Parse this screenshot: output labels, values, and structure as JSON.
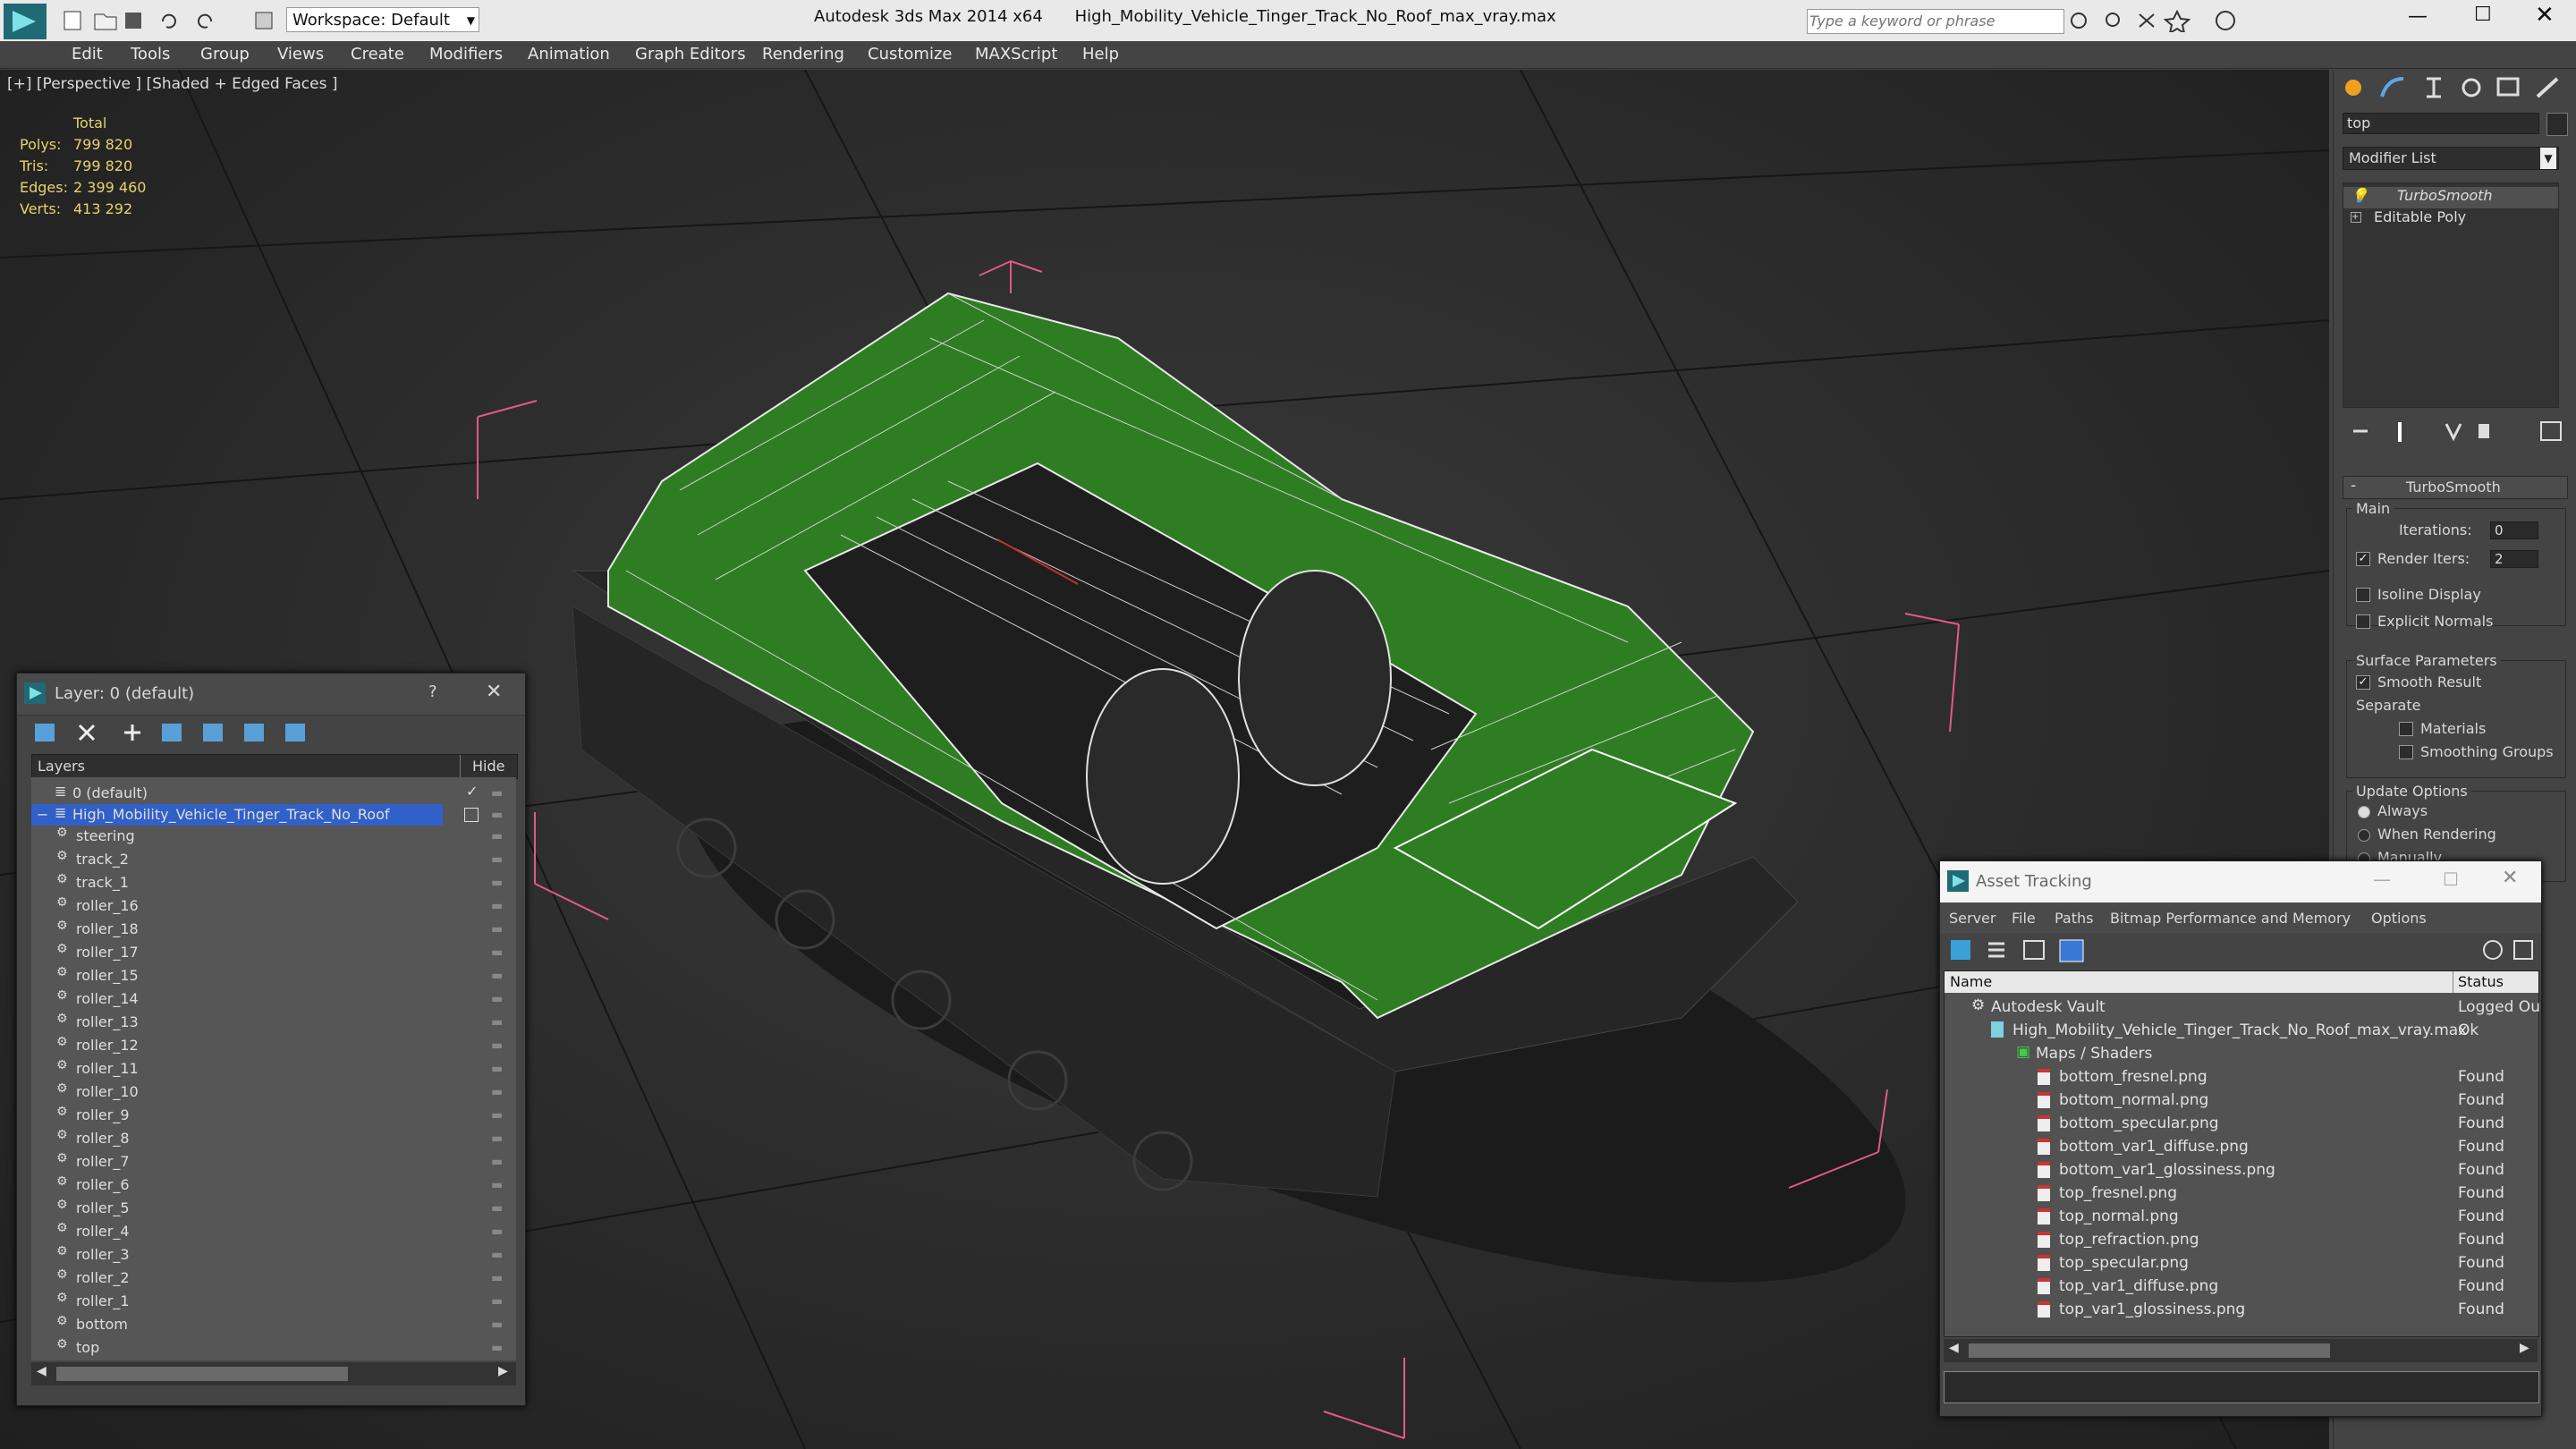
{
  "app": {
    "product": "Autodesk 3ds Max  2014 x64",
    "filename": "High_Mobility_Vehicle_Tinger_Track_No_Roof_max_vray.max",
    "workspace": "Workspace: Default",
    "search_placeholder": "Type a keyword or phrase"
  },
  "menu": [
    "Edit",
    "Tools",
    "Group",
    "Views",
    "Create",
    "Modifiers",
    "Animation",
    "Graph Editors",
    "Rendering",
    "Customize",
    "MAXScript",
    "Help"
  ],
  "viewport": {
    "label": "[+] [Perspective ] [Shaded + Edged Faces ]",
    "stats": {
      "header": "Total",
      "polys_label": "Polys:",
      "polys": "799 820",
      "tris_label": "Tris:",
      "tris": "799 820",
      "edges_label": "Edges:",
      "edges": "2 399 460",
      "verts_label": "Verts:",
      "verts": "413 292"
    }
  },
  "command_panel": {
    "object_name": "top",
    "modifier_list": "Modifier List",
    "stack": [
      "TurboSmooth",
      "Editable Poly"
    ],
    "rollout_title": "TurboSmooth",
    "main_group": "Main",
    "iterations_label": "Iterations:",
    "iterations_value": "0",
    "render_iters_label": "Render Iters:",
    "render_iters_value": "2",
    "isoline": "Isoline Display",
    "explicit_normals": "Explicit Normals",
    "surface_group": "Surface Parameters",
    "smooth_result": "Smooth Result",
    "separate": "Separate",
    "materials": "Materials",
    "smoothing_groups": "Smoothing Groups",
    "update_group": "Update Options",
    "always": "Always",
    "when_rendering": "When Rendering",
    "manually": "Manually"
  },
  "layer_window": {
    "title": "Layer: 0 (default)",
    "help": "?",
    "col_layers": "Layers",
    "col_hide": "Hide",
    "layers": [
      {
        "name": "0 (default)",
        "indent": 0
      },
      {
        "name": "High_Mobility_Vehicle_Tinger_Track_No_Roof",
        "indent": 0,
        "selected": true
      }
    ],
    "objects": [
      "steering",
      "track_2",
      "track_1",
      "roller_16",
      "roller_18",
      "roller_17",
      "roller_15",
      "roller_14",
      "roller_13",
      "roller_12",
      "roller_11",
      "roller_10",
      "roller_9",
      "roller_8",
      "roller_7",
      "roller_6",
      "roller_5",
      "roller_4",
      "roller_3",
      "roller_2",
      "roller_1",
      "bottom",
      "top",
      "High_Mobility_Vehicle_Tinger_Track_No_Roof"
    ]
  },
  "asset_window": {
    "title": "Asset Tracking",
    "menu": [
      "Server",
      "File",
      "Paths",
      "Bitmap Performance and Memory",
      "Options"
    ],
    "col_name": "Name",
    "col_status": "Status",
    "vault": {
      "name": "Autodesk Vault",
      "status": "Logged Ou"
    },
    "file": {
      "name": "High_Mobility_Vehicle_Tinger_Track_No_Roof_max_vray.max",
      "status": "Ok"
    },
    "group": "Maps / Shaders",
    "maps": [
      {
        "name": "bottom_fresnel.png",
        "status": "Found"
      },
      {
        "name": "bottom_normal.png",
        "status": "Found"
      },
      {
        "name": "bottom_specular.png",
        "status": "Found"
      },
      {
        "name": "bottom_var1_diffuse.png",
        "status": "Found"
      },
      {
        "name": "bottom_var1_glossiness.png",
        "status": "Found"
      },
      {
        "name": "top_fresnel.png",
        "status": "Found"
      },
      {
        "name": "top_normal.png",
        "status": "Found"
      },
      {
        "name": "top_refraction.png",
        "status": "Found"
      },
      {
        "name": "top_specular.png",
        "status": "Found"
      },
      {
        "name": "top_var1_diffuse.png",
        "status": "Found"
      },
      {
        "name": "top_var1_glossiness.png",
        "status": "Found"
      }
    ]
  },
  "colors": {
    "accent": "#3a78d6",
    "selection": "#3060c8",
    "vehicle_green": "#2e7d22",
    "gizmo": "#e05a8a",
    "stats": "#e6d36a"
  }
}
